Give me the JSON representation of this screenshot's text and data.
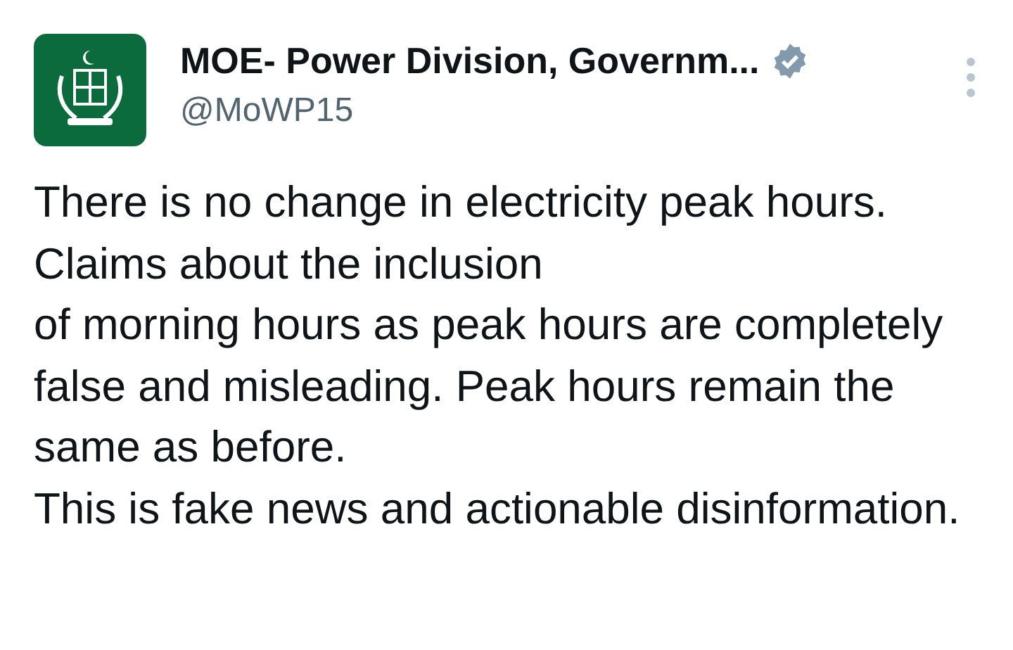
{
  "author": {
    "name": "MOE- Power Division, Governm...",
    "handle": "@MoWP15",
    "verified": true
  },
  "post": {
    "text": "There is no change in electricity peak hours. Claims about the inclusion\nof morning hours as peak hours are completely false and misleading. Peak hours remain the same as before.\nThis is fake news and actionable disinformation."
  }
}
